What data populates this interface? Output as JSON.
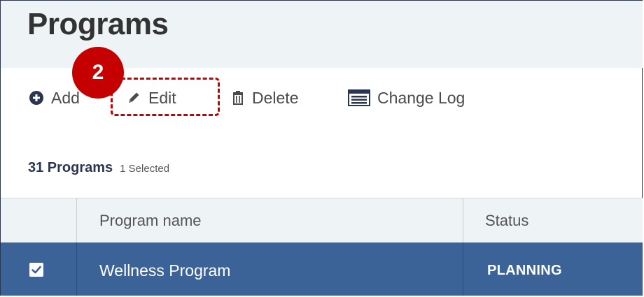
{
  "header": {
    "title": "Programs"
  },
  "callout": {
    "number": "2"
  },
  "toolbar": {
    "add_label": "Add",
    "edit_label": "Edit",
    "delete_label": "Delete",
    "change_log_label": "Change Log"
  },
  "summary": {
    "count_label": "31 Programs",
    "selected_label": "1  Selected"
  },
  "table": {
    "columns": [
      "Program name",
      "Status"
    ],
    "rows": [
      {
        "checked": true,
        "program_name": "Wellness Program",
        "status": "PLANNING"
      }
    ]
  },
  "colors": {
    "accent_red": "#c40000",
    "selected_row": "#3c6397",
    "header_bg": "#eef3f5",
    "title_dark": "#2a3550"
  },
  "icons": {
    "add": "plus-circle-icon",
    "edit": "pencil-icon",
    "delete": "trash-icon",
    "change_log": "list-window-icon",
    "checkbox": "check-icon"
  }
}
